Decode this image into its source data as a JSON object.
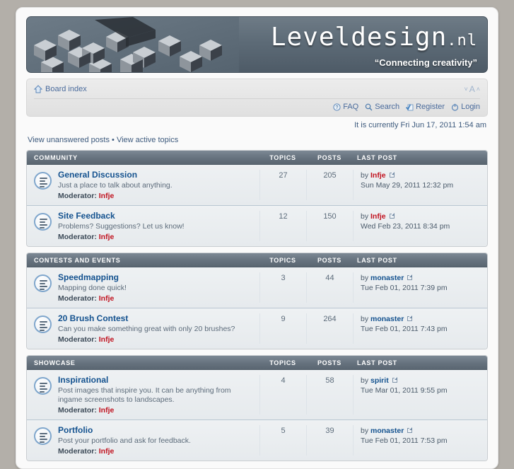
{
  "site": {
    "logo_text": "Leveldesign",
    "logo_tld": ".nl",
    "tagline": "“Connecting creativity”"
  },
  "nav": {
    "breadcrumb_label": "Board index",
    "home_icon": "home-icon",
    "font_decrease": "˅",
    "font_reset": "A",
    "font_increase": "˄",
    "links": [
      {
        "label": "FAQ",
        "icon": "faq-icon"
      },
      {
        "label": "Search",
        "icon": "search-icon"
      },
      {
        "label": "Register",
        "icon": "register-icon"
      },
      {
        "label": "Login",
        "icon": "login-icon"
      }
    ]
  },
  "status": {
    "current_time": "It is currently Fri Jun 17, 2011 1:54 am"
  },
  "quicklinks": {
    "unanswered": "View unanswered posts",
    "separator": "•",
    "active": "View active topics"
  },
  "columns": {
    "topics": "TOPICS",
    "posts": "POSTS",
    "last_post": "LAST POST"
  },
  "labels": {
    "moderator": "Moderator:",
    "by": "by"
  },
  "categories": [
    {
      "name": "COMMUNITY",
      "forums": [
        {
          "title": "General Discussion",
          "desc": "Just a place to talk about anything.",
          "moderator": "Infje",
          "moderator_color": "red",
          "topics": "27",
          "posts": "205",
          "last_author": "Infje",
          "last_author_color": "red",
          "last_date": "Sun May 29, 2011 12:32 pm"
        },
        {
          "title": "Site Feedback",
          "desc": "Problems? Suggestions? Let us know!",
          "moderator": "Infje",
          "moderator_color": "red",
          "topics": "12",
          "posts": "150",
          "last_author": "Infje",
          "last_author_color": "red",
          "last_date": "Wed Feb 23, 2011 8:34 pm"
        }
      ]
    },
    {
      "name": "CONTESTS AND EVENTS",
      "forums": [
        {
          "title": "Speedmapping",
          "desc": "Mapping done quick!",
          "moderator": "Infje",
          "moderator_color": "red",
          "topics": "3",
          "posts": "44",
          "last_author": "monaster",
          "last_author_color": "blue",
          "last_date": "Tue Feb 01, 2011 7:39 pm"
        },
        {
          "title": "20 Brush Contest",
          "desc": "Can you make something great with only 20 brushes?",
          "moderator": "Infje",
          "moderator_color": "red",
          "topics": "9",
          "posts": "264",
          "last_author": "monaster",
          "last_author_color": "blue",
          "last_date": "Tue Feb 01, 2011 7:43 pm"
        }
      ]
    },
    {
      "name": "SHOWCASE",
      "forums": [
        {
          "title": "Inspirational",
          "desc": "Post images that inspire you. It can be anything from ingame screenshots to landscapes.",
          "moderator": "Infje",
          "moderator_color": "red",
          "topics": "4",
          "posts": "58",
          "last_author": "spirit",
          "last_author_color": "blue",
          "last_date": "Tue Mar 01, 2011 9:55 pm"
        },
        {
          "title": "Portfolio",
          "desc": "Post your portfolio and ask for feedback.",
          "moderator": "Infje",
          "moderator_color": "red",
          "topics": "5",
          "posts": "39",
          "last_author": "monaster",
          "last_author_color": "blue",
          "last_date": "Tue Feb 01, 2011 7:53 pm"
        }
      ]
    }
  ],
  "colors": {
    "link": "#14528f",
    "moderator_red": "#c1121f",
    "header_slate": "#5d6b77",
    "page_bg": "#b3afa9"
  }
}
